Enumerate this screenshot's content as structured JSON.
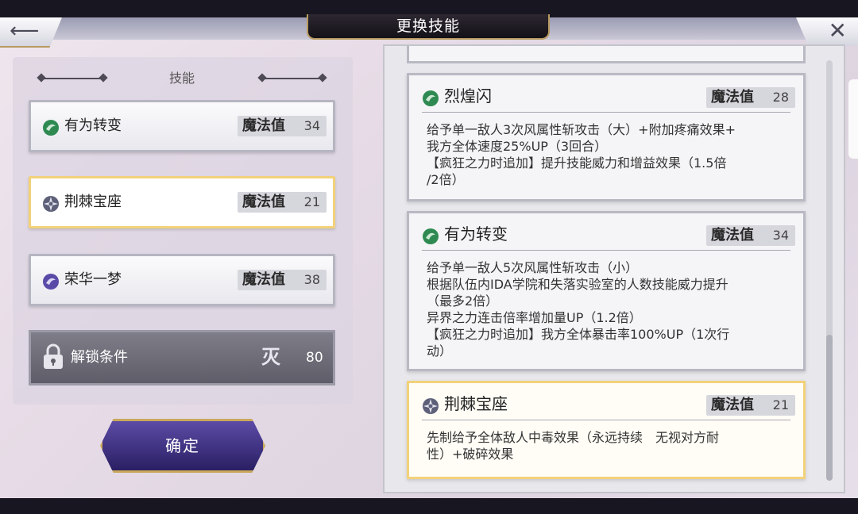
{
  "header": {
    "title": "更换技能",
    "back_icon": "back-arrow-icon",
    "close_icon": "close-icon"
  },
  "skills_panel": {
    "heading": "技能",
    "cost_label": "魔法值",
    "slots": [
      {
        "name": "有为转变",
        "cost": "34",
        "icon": "wind-orb-icon",
        "selected": false
      },
      {
        "name": "荆棘宝座",
        "cost": "21",
        "icon": "thorn-sigil-icon",
        "selected": true
      },
      {
        "name": "荣华一梦",
        "cost": "38",
        "icon": "dream-orb-icon",
        "selected": false
      }
    ],
    "unlock": {
      "label": "解锁条件",
      "glyph": "灭",
      "value": "80",
      "icon": "lock-icon"
    },
    "confirm_label": "确定"
  },
  "detail_list": {
    "cost_label": "魔法值",
    "cards": [
      {
        "name": "烈煌闪",
        "cost": "28",
        "icon": "wind-orb-icon",
        "desc": "给予单一敌人3次风属性斩攻击（大）+附加疼痛效果+\n我方全体速度25%UP（3回合）\n【疯狂之力时追加】提升技能威力和增益效果（1.5倍\n/2倍）"
      },
      {
        "name": "有为转变",
        "cost": "34",
        "icon": "wind-orb-icon",
        "desc": "给予单一敌人5次风属性斩攻击（小）\n根据队伍内IDA学院和失落实验室的人数技能威力提升\n（最多2倍）\n异界之力连击倍率增加量UP（1.2倍）\n【疯狂之力时追加】我方全体暴击率100%UP（1次行\n动）"
      },
      {
        "name": "荆棘宝座",
        "cost": "21",
        "icon": "thorn-sigil-icon",
        "selected": true,
        "desc": "先制给予全体敌人中毒效果（永远持续　无视对方耐\n性）+破碎效果"
      }
    ]
  },
  "colors": {
    "accent_gold": "#f2d27a",
    "wind_green": "#2f8a52",
    "confirm_purple": "#3d2f86"
  }
}
